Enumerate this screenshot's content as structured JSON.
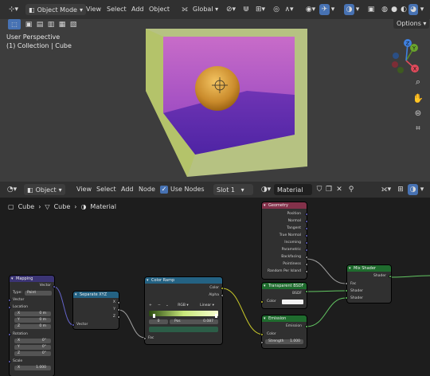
{
  "viewport_header": {
    "mode": "Object Mode",
    "menus": [
      "View",
      "Select",
      "Add",
      "Object"
    ],
    "transform_orientation": "Global",
    "options": "Options"
  },
  "viewport": {
    "perspective": "User Perspective",
    "collection": "(1) Collection | Cube",
    "gizmo": {
      "x": "X",
      "y": "Y",
      "z": "Z"
    }
  },
  "node_header": {
    "editor": "Object",
    "menus": [
      "View",
      "Select",
      "Add",
      "Node"
    ],
    "use_nodes": "Use Nodes",
    "slot": "Slot 1",
    "material": "Material"
  },
  "breadcrumb": [
    "Cube",
    "Cube",
    "Material"
  ],
  "nodes": {
    "mapping": {
      "title": "Mapping",
      "out_vector": "Vector",
      "type_label": "Type:",
      "type_value": "Point",
      "in_vector": "Vector",
      "location": "Location",
      "loc": [
        "X",
        "0 m",
        "Y",
        "0 m",
        "Z",
        "0 m"
      ],
      "rotation": "Rotation",
      "rot": [
        "X",
        "0°",
        "Y",
        "0°",
        "Z",
        "0°"
      ],
      "scale": "Scale",
      "sx": [
        "X",
        "1.000"
      ]
    },
    "separate": {
      "title": "Separate XYZ",
      "outs": [
        "X",
        "Y",
        "Z"
      ],
      "in_vector": "Vector"
    },
    "ramp": {
      "title": "Color Ramp",
      "color": "Color",
      "alpha": "Alpha",
      "mode": "RGB",
      "interp": "Linear",
      "index": "0",
      "pos_label": "Pos",
      "pos_value": "0.087",
      "fac": "Fac"
    },
    "geometry": {
      "title": "Geometry",
      "outs": [
        "Position",
        "Normal",
        "Tangent",
        "True Normal",
        "Incoming",
        "Parametric",
        "Backfacing",
        "Pointiness",
        "Random Per Island"
      ]
    },
    "transparent": {
      "title": "Transparent BSDF",
      "bsdf": "BSDF",
      "color": "Color"
    },
    "emission": {
      "title": "Emission",
      "out": "Emission",
      "color": "Color",
      "strength_label": "Strength",
      "strength_value": "1.000"
    },
    "mix": {
      "title": "Mix Shader",
      "out": "Shader",
      "fac": "Fac",
      "in1": "Shader",
      "in2": "Shader"
    }
  },
  "colors": {
    "accent": "#4772b3",
    "mapping_header": "#3b3474",
    "util_header": "#246283",
    "input_header": "#83314a",
    "shader_header": "#1f6c2e",
    "geo_sock": "#6363c7",
    "color_sock": "#c7c729",
    "gray_sock": "#a1a1a1",
    "shader_sock": "#63c763"
  }
}
